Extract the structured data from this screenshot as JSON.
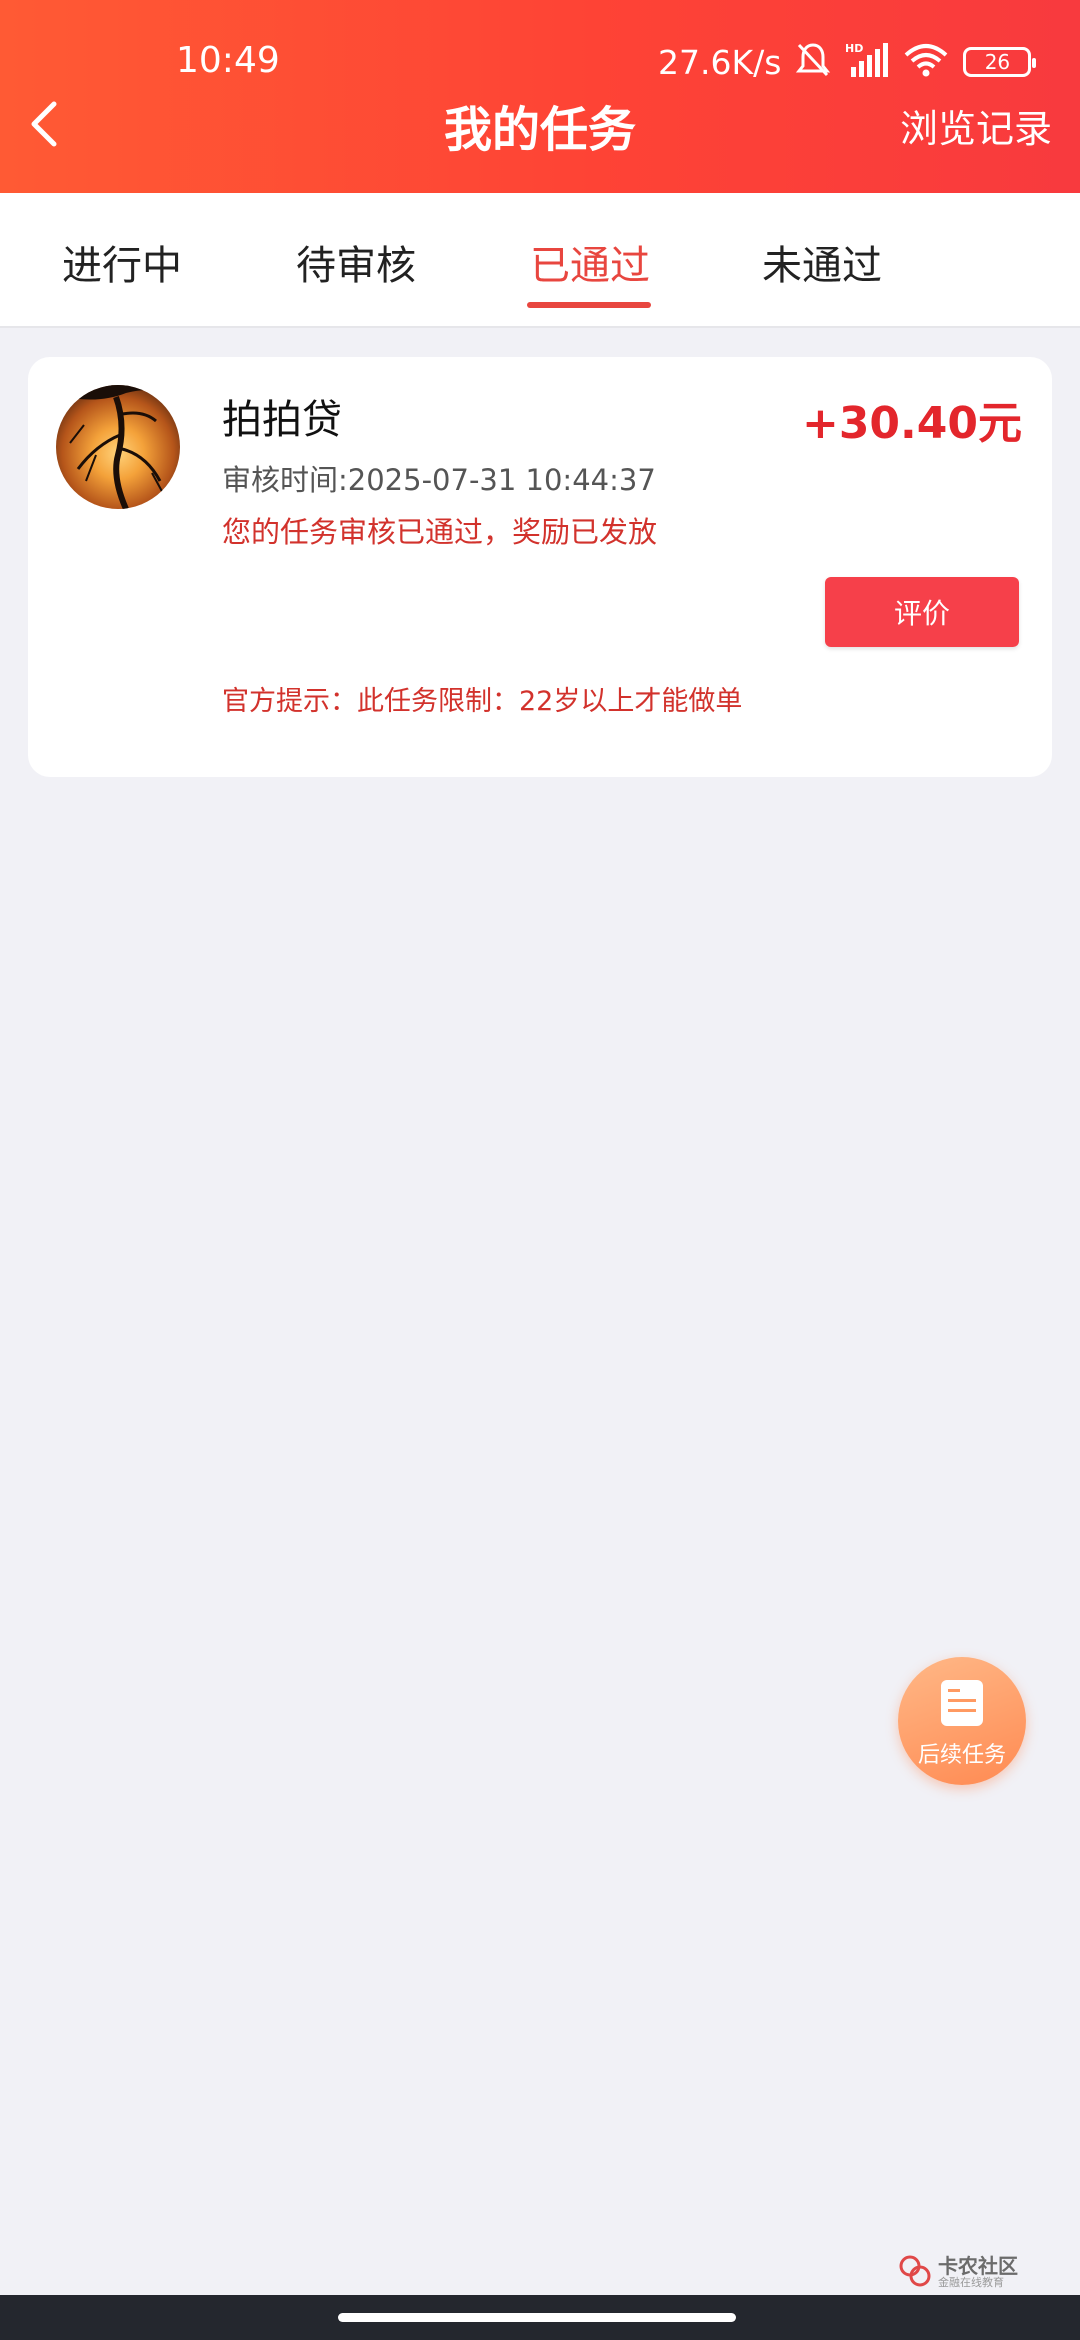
{
  "status_bar": {
    "time": "10:49",
    "net_speed": "27.6K/s",
    "battery": "26"
  },
  "header": {
    "title": "我的任务",
    "history_label": "浏览记录"
  },
  "tabs": [
    {
      "label": "进行中",
      "active": false
    },
    {
      "label": "待审核",
      "active": false
    },
    {
      "label": "已通过",
      "active": true
    },
    {
      "label": "未通过",
      "active": false
    }
  ],
  "task_card": {
    "name": "拍拍贷",
    "reward": "+30.40元",
    "review_time": "审核时间:2025-07-31 10:44:37",
    "status_message": "您的任务审核已通过，奖励已发放",
    "rate_button": "评价",
    "official_tip": "官方提示：此任务限制：22岁以上才能做单"
  },
  "fab": {
    "label": "后续任务"
  },
  "watermark": {
    "title": "卡农社区",
    "subtitle": "金融在线教育"
  },
  "colors": {
    "header_start": "#ff5a34",
    "header_end": "#f83a3e",
    "accent_red": "#e3262c",
    "tab_active": "#e8463f",
    "button_red": "#f6404a",
    "fab_orange": "#ff8a52"
  }
}
